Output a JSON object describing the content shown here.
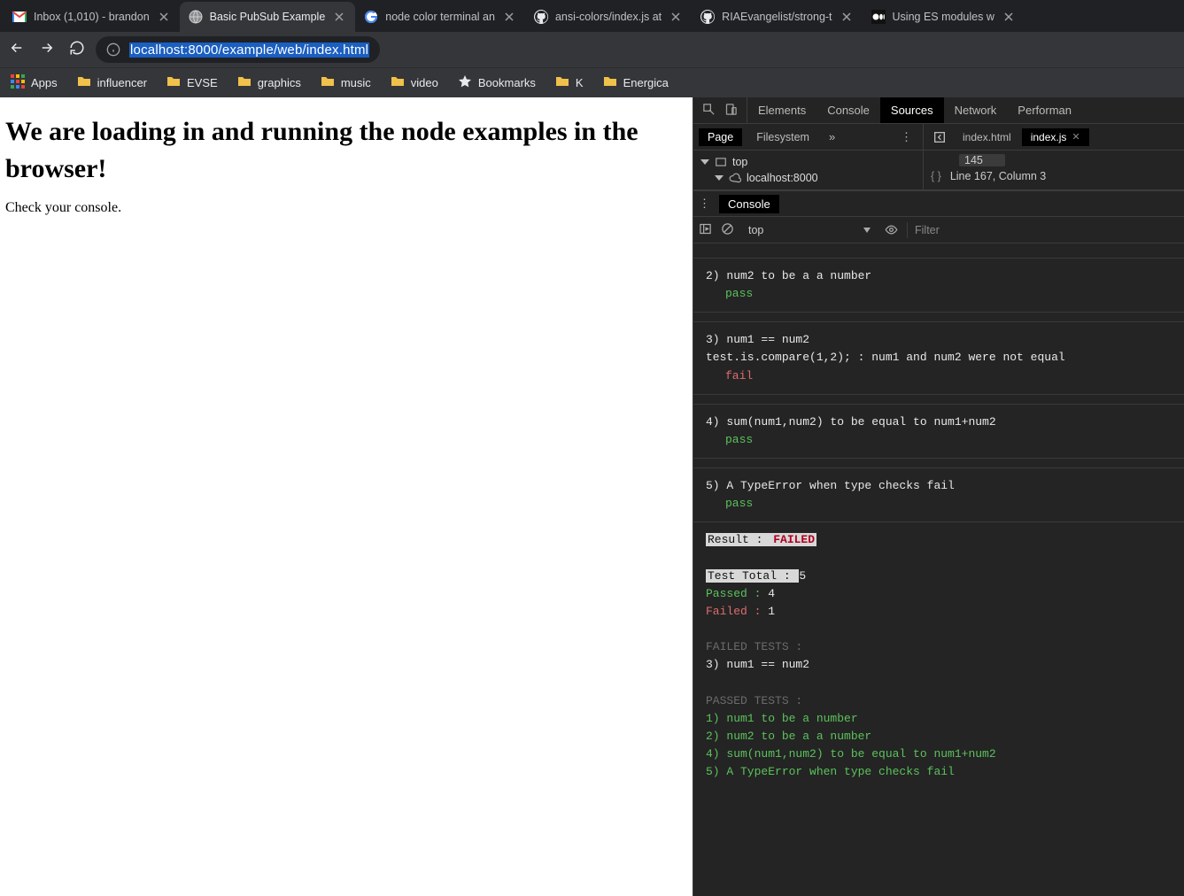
{
  "tabs": [
    {
      "title": "Inbox (1,010) - brandon",
      "favicon": "gmail"
    },
    {
      "title": "Basic PubSub Example",
      "favicon": "globe",
      "active": true
    },
    {
      "title": "node color terminal an",
      "favicon": "google"
    },
    {
      "title": "ansi-colors/index.js at",
      "favicon": "github"
    },
    {
      "title": "RIAEvangelist/strong-t",
      "favicon": "github"
    },
    {
      "title": "Using ES modules w",
      "favicon": "medium"
    }
  ],
  "omnibox": {
    "scheme_hidden": "",
    "url": "localhost:8000/example/web/index.html"
  },
  "bookmarks": [
    {
      "label": "Apps",
      "icon": "apps"
    },
    {
      "label": "influencer",
      "icon": "folder"
    },
    {
      "label": "EVSE",
      "icon": "folder"
    },
    {
      "label": "graphics",
      "icon": "folder"
    },
    {
      "label": "music",
      "icon": "folder"
    },
    {
      "label": "video",
      "icon": "folder"
    },
    {
      "label": "Bookmarks",
      "icon": "star"
    },
    {
      "label": "K",
      "icon": "folder"
    },
    {
      "label": "Energica",
      "icon": "folder"
    }
  ],
  "page": {
    "heading": "We are loading in and running the node examples in the browser!",
    "body": "Check your console."
  },
  "devtools": {
    "panels": [
      "Elements",
      "Console",
      "Sources",
      "Network",
      "Performan"
    ],
    "active_panel": "Sources",
    "sources": {
      "nav_tabs": [
        "Page",
        "Filesystem"
      ],
      "nav_active": "Page",
      "tree_top": "top",
      "tree_host": "localhost:8000",
      "open_files": [
        "index.html",
        "index.js"
      ],
      "active_file": "index.js",
      "line_box": "145",
      "cursor_info": "Line 167, Column 3"
    },
    "drawer_label": "Console",
    "console_toolbar": {
      "context": "top",
      "filter_placeholder": "Filter"
    },
    "console": {
      "groups": [
        {
          "lines": [
            {
              "text": "2) num2 to be a a number",
              "class": "c-white"
            },
            {
              "text": "pass",
              "class": "c-green pl-ind"
            }
          ]
        },
        {
          "lines": [
            {
              "text": "3) num1 == num2",
              "class": "c-white"
            },
            {
              "text": "test.is.compare(1,2); : num1 and num2 were not equal",
              "class": "c-white"
            },
            {
              "text": "fail",
              "class": "c-red pl-ind"
            }
          ]
        },
        {
          "lines": [
            {
              "text": "4) sum(num1,num2) to be equal to num1+num2",
              "class": "c-white"
            },
            {
              "text": "pass",
              "class": "c-green pl-ind"
            }
          ]
        },
        {
          "lines": [
            {
              "text": "5) A TypeError when type checks fail",
              "class": "c-white"
            },
            {
              "text": "pass",
              "class": "c-green pl-ind"
            }
          ]
        }
      ],
      "summary": {
        "result_label": "Result : ",
        "result_value": "FAILED",
        "total_label": "Test Total : ",
        "total_value": "5",
        "passed_label": "Passed : ",
        "passed_value": "4",
        "failed_label": "Failed : ",
        "failed_value": "1",
        "failed_header": "FAILED TESTS :",
        "failed_list": [
          "3) num1 == num2"
        ],
        "passed_header": "PASSED TESTS :",
        "passed_list": [
          "1) num1 to be a number",
          "2) num2 to be a a number",
          "4) sum(num1,num2) to be equal to num1+num2",
          "5) A TypeError when type checks fail"
        ]
      }
    }
  }
}
